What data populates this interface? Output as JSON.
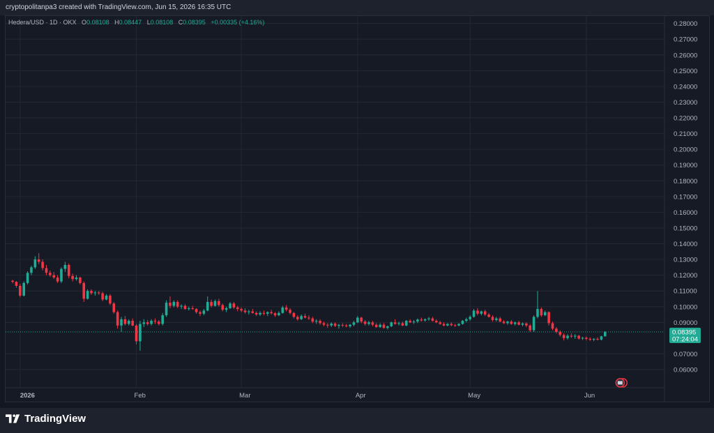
{
  "caption": "cryptopolitanpa3 created with TradingView.com, Jun 15, 2026 16:35 UTC",
  "legend": {
    "symbol": "Hedera/USD · 1D · OKX",
    "o_label": "O",
    "o_value": "0.08108",
    "h_label": "H",
    "h_value": "0.08447",
    "l_label": "L",
    "l_value": "0.08108",
    "c_label": "C",
    "c_value": "0.08395",
    "change": "+0.00335 (+4.16%)"
  },
  "brand": {
    "name": "TradingView"
  },
  "colors": {
    "up": "#22ab94",
    "down": "#f23645",
    "background": "#161a25",
    "grid": "#242833",
    "text": "#b2b5be"
  },
  "chart_data": {
    "type": "candlestick",
    "y_ticks": [
      "0.28000",
      "0.27000",
      "0.26000",
      "0.25000",
      "0.24000",
      "0.23000",
      "0.22000",
      "0.21000",
      "0.20000",
      "0.19000",
      "0.18000",
      "0.17000",
      "0.16000",
      "0.15000",
      "0.14000",
      "0.13000",
      "0.12000",
      "0.11000",
      "0.10000",
      "0.09000",
      "0.07000",
      "0.06000"
    ],
    "ylim": [
      0.0538,
      0.2825
    ],
    "x_labels": [
      {
        "label": "2026",
        "day": 0
      },
      {
        "label": "Feb",
        "day": 31
      },
      {
        "label": "Mar",
        "day": 59
      },
      {
        "label": "Apr",
        "day": 90
      },
      {
        "label": "May",
        "day": 120
      },
      {
        "label": "Jun",
        "day": 151
      }
    ],
    "xlim": [
      -3.5,
      183
    ],
    "last_price": "0.08395",
    "countdown": "07:24:04",
    "candles": [
      [
        -2,
        0.1165,
        0.117,
        0.1148,
        0.1158
      ],
      [
        -1,
        0.1158,
        0.1162,
        0.112,
        0.1132
      ],
      [
        0,
        0.1132,
        0.1145,
        0.106,
        0.107
      ],
      [
        1,
        0.107,
        0.116,
        0.1065,
        0.115
      ],
      [
        2,
        0.115,
        0.1225,
        0.114,
        0.1215
      ],
      [
        3,
        0.1215,
        0.126,
        0.12,
        0.125
      ],
      [
        4,
        0.125,
        0.132,
        0.124,
        0.13
      ],
      [
        5,
        0.13,
        0.134,
        0.127,
        0.1285
      ],
      [
        6,
        0.1285,
        0.13,
        0.123,
        0.1245
      ],
      [
        7,
        0.1245,
        0.1265,
        0.12,
        0.1215
      ],
      [
        8,
        0.1215,
        0.123,
        0.119,
        0.12
      ],
      [
        9,
        0.12,
        0.122,
        0.1175,
        0.1185
      ],
      [
        10,
        0.1185,
        0.12,
        0.115,
        0.116
      ],
      [
        11,
        0.116,
        0.125,
        0.115,
        0.124
      ],
      [
        12,
        0.124,
        0.1285,
        0.122,
        0.1265
      ],
      [
        13,
        0.1265,
        0.1275,
        0.118,
        0.1195
      ],
      [
        14,
        0.1195,
        0.121,
        0.116,
        0.1175
      ],
      [
        15,
        0.1175,
        0.12,
        0.1165,
        0.1185
      ],
      [
        16,
        0.1185,
        0.119,
        0.114,
        0.115
      ],
      [
        17,
        0.115,
        0.116,
        0.103,
        0.105
      ],
      [
        18,
        0.105,
        0.111,
        0.1045,
        0.11
      ],
      [
        19,
        0.11,
        0.111,
        0.1075,
        0.1085
      ],
      [
        20,
        0.1085,
        0.11,
        0.107,
        0.109
      ],
      [
        21,
        0.109,
        0.11,
        0.1075,
        0.1085
      ],
      [
        22,
        0.1085,
        0.1095,
        0.1035,
        0.1045
      ],
      [
        23,
        0.1045,
        0.108,
        0.104,
        0.107
      ],
      [
        24,
        0.107,
        0.108,
        0.101,
        0.102
      ],
      [
        25,
        0.102,
        0.103,
        0.0955,
        0.0965
      ],
      [
        26,
        0.0965,
        0.0975,
        0.086,
        0.088
      ],
      [
        27,
        0.088,
        0.0935,
        0.084,
        0.092
      ],
      [
        28,
        0.092,
        0.094,
        0.088,
        0.089
      ],
      [
        29,
        0.089,
        0.092,
        0.088,
        0.091
      ],
      [
        30,
        0.091,
        0.0925,
        0.0875,
        0.088
      ],
      [
        31,
        0.088,
        0.089,
        0.076,
        0.078
      ],
      [
        32,
        0.078,
        0.091,
        0.072,
        0.089
      ],
      [
        33,
        0.089,
        0.092,
        0.087,
        0.09
      ],
      [
        34,
        0.09,
        0.0915,
        0.088,
        0.089
      ],
      [
        35,
        0.089,
        0.092,
        0.088,
        0.091
      ],
      [
        36,
        0.091,
        0.0925,
        0.089,
        0.0905
      ],
      [
        37,
        0.0905,
        0.0915,
        0.088,
        0.089
      ],
      [
        38,
        0.089,
        0.096,
        0.088,
        0.0945
      ],
      [
        39,
        0.0945,
        0.104,
        0.0935,
        0.1025
      ],
      [
        40,
        0.1025,
        0.1065,
        0.099,
        0.1005
      ],
      [
        41,
        0.1005,
        0.104,
        0.0995,
        0.103
      ],
      [
        42,
        0.103,
        0.104,
        0.099,
        0.1
      ],
      [
        43,
        0.1,
        0.1015,
        0.0985,
        0.1005
      ],
      [
        44,
        0.1005,
        0.1015,
        0.098,
        0.0985
      ],
      [
        45,
        0.0985,
        0.1,
        0.0975,
        0.099
      ],
      [
        46,
        0.099,
        0.1005,
        0.098,
        0.0985
      ],
      [
        47,
        0.0985,
        0.099,
        0.0955,
        0.0965
      ],
      [
        48,
        0.0965,
        0.0975,
        0.094,
        0.0955
      ],
      [
        49,
        0.0955,
        0.0985,
        0.0945,
        0.0975
      ],
      [
        50,
        0.0975,
        0.1065,
        0.097,
        0.103
      ],
      [
        51,
        0.103,
        0.1045,
        0.0995,
        0.1005
      ],
      [
        52,
        0.1005,
        0.1045,
        0.1,
        0.1035
      ],
      [
        53,
        0.1035,
        0.105,
        0.1,
        0.101
      ],
      [
        54,
        0.101,
        0.102,
        0.097,
        0.098
      ],
      [
        55,
        0.098,
        0.1,
        0.0965,
        0.099
      ],
      [
        56,
        0.099,
        0.103,
        0.0985,
        0.102
      ],
      [
        57,
        0.102,
        0.103,
        0.0985,
        0.0995
      ],
      [
        58,
        0.0995,
        0.1005,
        0.097,
        0.0985
      ],
      [
        59,
        0.0985,
        0.0995,
        0.0965,
        0.0975
      ],
      [
        60,
        0.0975,
        0.099,
        0.0955,
        0.0965
      ],
      [
        61,
        0.0965,
        0.098,
        0.095,
        0.097
      ],
      [
        62,
        0.097,
        0.0985,
        0.0955,
        0.096
      ],
      [
        63,
        0.096,
        0.097,
        0.094,
        0.095
      ],
      [
        64,
        0.095,
        0.097,
        0.094,
        0.096
      ],
      [
        65,
        0.096,
        0.0975,
        0.0945,
        0.0955
      ],
      [
        66,
        0.0955,
        0.097,
        0.094,
        0.0965
      ],
      [
        67,
        0.0965,
        0.098,
        0.095,
        0.0958
      ],
      [
        68,
        0.0958,
        0.0965,
        0.0935,
        0.0945
      ],
      [
        69,
        0.0945,
        0.097,
        0.094,
        0.096
      ],
      [
        70,
        0.096,
        0.1005,
        0.0955,
        0.0995
      ],
      [
        71,
        0.0995,
        0.101,
        0.097,
        0.098
      ],
      [
        72,
        0.098,
        0.099,
        0.095,
        0.096
      ],
      [
        73,
        0.096,
        0.0965,
        0.0925,
        0.0935
      ],
      [
        74,
        0.0935,
        0.0945,
        0.091,
        0.092
      ],
      [
        75,
        0.092,
        0.095,
        0.0915,
        0.094
      ],
      [
        76,
        0.094,
        0.0955,
        0.0925,
        0.093
      ],
      [
        77,
        0.093,
        0.0945,
        0.0915,
        0.0925
      ],
      [
        78,
        0.0925,
        0.0935,
        0.0895,
        0.0905
      ],
      [
        79,
        0.0905,
        0.092,
        0.089,
        0.091
      ],
      [
        80,
        0.091,
        0.092,
        0.0885,
        0.0895
      ],
      [
        81,
        0.0895,
        0.0905,
        0.0875,
        0.0885
      ],
      [
        82,
        0.0885,
        0.0895,
        0.0865,
        0.088
      ],
      [
        83,
        0.088,
        0.09,
        0.087,
        0.0892
      ],
      [
        84,
        0.0892,
        0.09,
        0.087,
        0.0878
      ],
      [
        85,
        0.0878,
        0.089,
        0.086,
        0.0884
      ],
      [
        86,
        0.0884,
        0.0895,
        0.087,
        0.088
      ],
      [
        87,
        0.088,
        0.089,
        0.0868,
        0.0875
      ],
      [
        88,
        0.0875,
        0.089,
        0.0865,
        0.0885
      ],
      [
        89,
        0.0885,
        0.091,
        0.0875,
        0.09
      ],
      [
        90,
        0.09,
        0.094,
        0.0895,
        0.093
      ],
      [
        91,
        0.093,
        0.0935,
        0.0895,
        0.0905
      ],
      [
        92,
        0.0905,
        0.0915,
        0.088,
        0.089
      ],
      [
        93,
        0.089,
        0.091,
        0.088,
        0.09
      ],
      [
        94,
        0.09,
        0.091,
        0.0875,
        0.0885
      ],
      [
        95,
        0.0885,
        0.0895,
        0.0865,
        0.087
      ],
      [
        96,
        0.087,
        0.0895,
        0.0865,
        0.0885
      ],
      [
        97,
        0.0885,
        0.0895,
        0.086,
        0.0865
      ],
      [
        98,
        0.0865,
        0.088,
        0.0855,
        0.0875
      ],
      [
        99,
        0.0875,
        0.0905,
        0.087,
        0.09
      ],
      [
        100,
        0.09,
        0.092,
        0.0885,
        0.089
      ],
      [
        101,
        0.089,
        0.0905,
        0.088,
        0.0895
      ],
      [
        102,
        0.0895,
        0.0905,
        0.0875,
        0.088
      ],
      [
        103,
        0.088,
        0.0915,
        0.0875,
        0.091
      ],
      [
        104,
        0.091,
        0.092,
        0.0895,
        0.09
      ],
      [
        105,
        0.09,
        0.0915,
        0.089,
        0.0905
      ],
      [
        106,
        0.0905,
        0.0925,
        0.0895,
        0.0918
      ],
      [
        107,
        0.0918,
        0.093,
        0.0905,
        0.0912
      ],
      [
        108,
        0.0912,
        0.0925,
        0.0905,
        0.092
      ],
      [
        109,
        0.092,
        0.0935,
        0.091,
        0.0925
      ],
      [
        110,
        0.0925,
        0.0935,
        0.0905,
        0.091
      ],
      [
        111,
        0.091,
        0.092,
        0.0895,
        0.09
      ],
      [
        112,
        0.09,
        0.091,
        0.0885,
        0.089
      ],
      [
        113,
        0.089,
        0.09,
        0.0875,
        0.088
      ],
      [
        114,
        0.088,
        0.0895,
        0.0875,
        0.089
      ],
      [
        115,
        0.089,
        0.09,
        0.0875,
        0.0882
      ],
      [
        116,
        0.0882,
        0.089,
        0.0872,
        0.088
      ],
      [
        117,
        0.088,
        0.0895,
        0.0875,
        0.089
      ],
      [
        118,
        0.089,
        0.0915,
        0.0885,
        0.091
      ],
      [
        119,
        0.091,
        0.093,
        0.09,
        0.092
      ],
      [
        120,
        0.092,
        0.0945,
        0.091,
        0.0935
      ],
      [
        121,
        0.0935,
        0.0985,
        0.093,
        0.0975
      ],
      [
        122,
        0.0975,
        0.099,
        0.0945,
        0.0955
      ],
      [
        123,
        0.0955,
        0.0975,
        0.0945,
        0.097
      ],
      [
        124,
        0.097,
        0.098,
        0.094,
        0.095
      ],
      [
        125,
        0.095,
        0.096,
        0.093,
        0.0935
      ],
      [
        126,
        0.0935,
        0.0945,
        0.0905,
        0.0915
      ],
      [
        127,
        0.0915,
        0.0935,
        0.0905,
        0.0925
      ],
      [
        128,
        0.0925,
        0.0935,
        0.09,
        0.0905
      ],
      [
        129,
        0.0905,
        0.0915,
        0.089,
        0.0895
      ],
      [
        130,
        0.0895,
        0.091,
        0.0885,
        0.0905
      ],
      [
        131,
        0.0905,
        0.0915,
        0.0885,
        0.089
      ],
      [
        132,
        0.089,
        0.0905,
        0.088,
        0.09
      ],
      [
        133,
        0.09,
        0.091,
        0.088,
        0.0885
      ],
      [
        134,
        0.0885,
        0.09,
        0.0875,
        0.0893
      ],
      [
        135,
        0.0893,
        0.09,
        0.087,
        0.088
      ],
      [
        136,
        0.088,
        0.089,
        0.084,
        0.085
      ],
      [
        137,
        0.085,
        0.0945,
        0.084,
        0.0935
      ],
      [
        138,
        0.0935,
        0.11,
        0.0925,
        0.0985
      ],
      [
        139,
        0.0985,
        0.0995,
        0.0935,
        0.0945
      ],
      [
        140,
        0.0945,
        0.0975,
        0.094,
        0.0965
      ],
      [
        141,
        0.0965,
        0.097,
        0.088,
        0.0895
      ],
      [
        142,
        0.0895,
        0.0905,
        0.085,
        0.086
      ],
      [
        143,
        0.086,
        0.087,
        0.083,
        0.084
      ],
      [
        144,
        0.084,
        0.085,
        0.081,
        0.082
      ],
      [
        145,
        0.082,
        0.083,
        0.0785,
        0.08
      ],
      [
        146,
        0.08,
        0.0825,
        0.079,
        0.0815
      ],
      [
        147,
        0.0815,
        0.083,
        0.08,
        0.081
      ],
      [
        148,
        0.081,
        0.0825,
        0.0795,
        0.0815
      ],
      [
        149,
        0.0815,
        0.082,
        0.079,
        0.0797
      ],
      [
        150,
        0.0797,
        0.0808,
        0.0788,
        0.0802
      ],
      [
        151,
        0.0802,
        0.081,
        0.0785,
        0.0795
      ],
      [
        152,
        0.0795,
        0.0805,
        0.0782,
        0.079
      ],
      [
        153,
        0.079,
        0.08,
        0.078,
        0.0795
      ],
      [
        154,
        0.0795,
        0.0805,
        0.0785,
        0.079
      ],
      [
        155,
        0.079,
        0.0815,
        0.0785,
        0.0811
      ],
      [
        156,
        0.08108,
        0.08447,
        0.08108,
        0.08395
      ]
    ]
  }
}
